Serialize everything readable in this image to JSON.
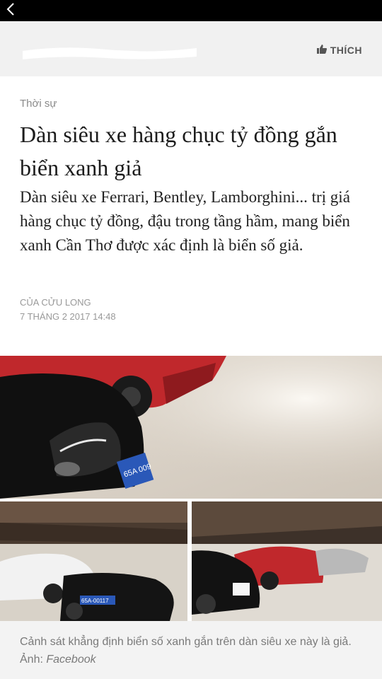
{
  "nav": {
    "back_icon": "chevron-left-icon"
  },
  "header": {
    "like_label": "THÍCH",
    "like_icon": "thumbs-up-icon"
  },
  "article": {
    "category": "Thời sự",
    "title": "Dàn siêu xe hàng chục tỷ đồng gắn biển xanh giả",
    "subtitle": "Dàn siêu xe Ferrari, Bentley, Lamborghini... trị giá hàng chục tỷ đồng, đậu trong tầng hầm, mang biển xanh Cần Thơ được xác định là biển số giả.",
    "author": "CỦA CỬU LONG",
    "date": "7 THÁNG 2 2017 14:48",
    "photos": {
      "main_plate": "65A 009",
      "left_plate": "65A-00117"
    },
    "caption": {
      "text": "Cảnh sát khẳng định biển số xanh gắn trên dàn siêu xe này là giả. Ảnh: ",
      "source": "Facebook"
    }
  },
  "colors": {
    "header_bg": "#f1f1f1",
    "plate_blue": "#2a58b8",
    "car_red": "#c0282c"
  }
}
